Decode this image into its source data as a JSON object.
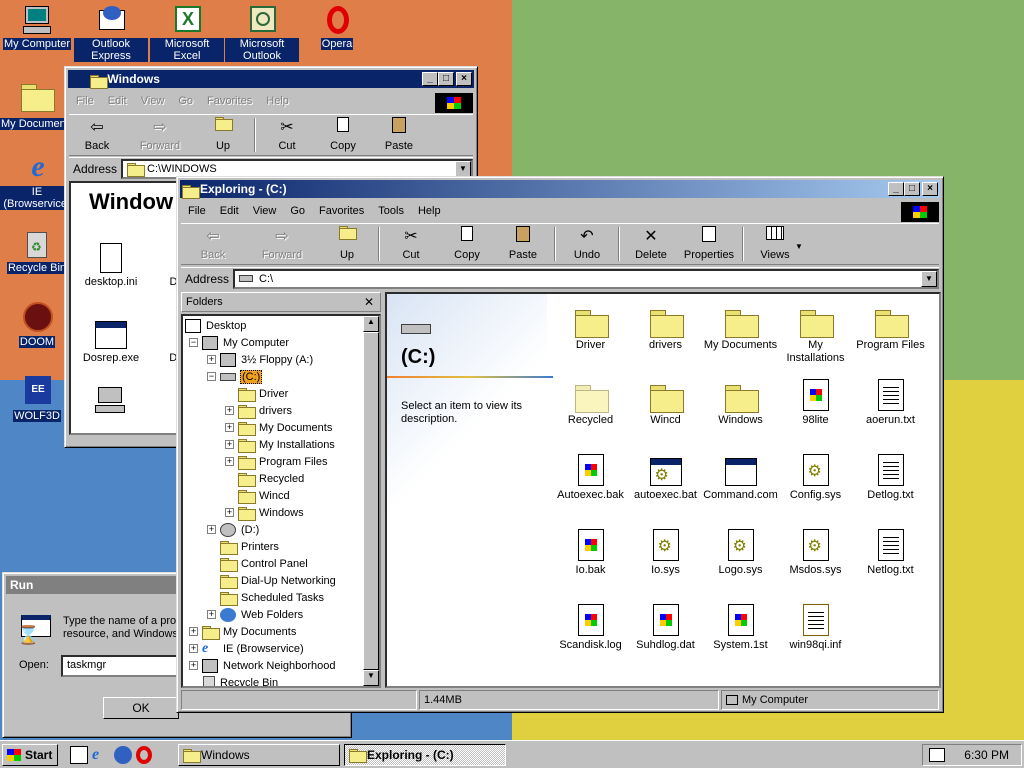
{
  "desktop": {
    "icons": [
      {
        "label": "My Computer",
        "icon": "computer-icon"
      },
      {
        "label": "Outlook Express",
        "icon": "outlook-express-icon"
      },
      {
        "label": "Microsoft Excel",
        "icon": "excel-icon"
      },
      {
        "label": "Microsoft Outlook",
        "icon": "outlook-icon"
      },
      {
        "label": "Opera",
        "icon": "opera-icon"
      },
      {
        "label": "My Documents",
        "icon": "documents-folder-icon"
      },
      {
        "label": "IE (Browservice)",
        "icon": "internet-explorer-icon"
      },
      {
        "label": "Recycle Bin",
        "icon": "recycle-bin-icon"
      },
      {
        "label": "DOOM",
        "icon": "doom-icon"
      },
      {
        "label": "WOLF3D",
        "icon": "wolf3d-icon"
      }
    ]
  },
  "windows_window": {
    "title": "Windows",
    "menu": [
      "File",
      "Edit",
      "View",
      "Go",
      "Favorites",
      "Help"
    ],
    "toolbar": [
      "Back",
      "Forward",
      "Up",
      "Cut",
      "Copy",
      "Paste"
    ],
    "address_label": "Address",
    "address_value": "C:\\WINDOWS",
    "heading": "Window",
    "items": [
      "desktop.ini",
      "Dial",
      "Dosrep.exe",
      "Dos"
    ]
  },
  "explorer": {
    "title": "Exploring - (C:)",
    "menu": [
      "File",
      "Edit",
      "View",
      "Go",
      "Favorites",
      "Tools",
      "Help"
    ],
    "toolbar": [
      "Back",
      "Forward",
      "Up",
      "Cut",
      "Copy",
      "Paste",
      "Undo",
      "Delete",
      "Properties",
      "Views"
    ],
    "address_label": "Address",
    "address_value": "C:\\",
    "folders_header": "Folders",
    "tree": [
      {
        "label": "Desktop"
      },
      {
        "label": "My Computer"
      },
      {
        "label": "3½ Floppy (A:)"
      },
      {
        "label": "(C:)"
      },
      {
        "label": "Driver"
      },
      {
        "label": "drivers"
      },
      {
        "label": "My Documents"
      },
      {
        "label": "My Installations"
      },
      {
        "label": "Program Files"
      },
      {
        "label": "Recycled"
      },
      {
        "label": "Wincd"
      },
      {
        "label": "Windows"
      },
      {
        "label": "(D:)"
      },
      {
        "label": "Printers"
      },
      {
        "label": "Control Panel"
      },
      {
        "label": "Dial-Up Networking"
      },
      {
        "label": "Scheduled Tasks"
      },
      {
        "label": "Web Folders"
      },
      {
        "label": "My Documents"
      },
      {
        "label": "IE (Browservice)"
      },
      {
        "label": "Network Neighborhood"
      },
      {
        "label": "Recycle Bin"
      }
    ],
    "drive_title": "(C:)",
    "drive_desc": "Select an item to view its description.",
    "files": [
      {
        "name": "Driver",
        "kind": "folder"
      },
      {
        "name": "drivers",
        "kind": "folder"
      },
      {
        "name": "My Documents",
        "kind": "folder"
      },
      {
        "name": "My Installations",
        "kind": "folder"
      },
      {
        "name": "Program Files",
        "kind": "folder"
      },
      {
        "name": "Recycled",
        "kind": "folder-pale"
      },
      {
        "name": "Wincd",
        "kind": "folder"
      },
      {
        "name": "Windows",
        "kind": "folder"
      },
      {
        "name": "98lite",
        "kind": "app"
      },
      {
        "name": "aoerun.txt",
        "kind": "text"
      },
      {
        "name": "Autoexec.bak",
        "kind": "winfile"
      },
      {
        "name": "autoexec.bat",
        "kind": "batch"
      },
      {
        "name": "Command.com",
        "kind": "winapp"
      },
      {
        "name": "Config.sys",
        "kind": "sys"
      },
      {
        "name": "Detlog.txt",
        "kind": "text"
      },
      {
        "name": "Io.bak",
        "kind": "winfile"
      },
      {
        "name": "Io.sys",
        "kind": "sys"
      },
      {
        "name": "Logo.sys",
        "kind": "sys"
      },
      {
        "name": "Msdos.sys",
        "kind": "sys"
      },
      {
        "name": "Netlog.txt",
        "kind": "text"
      },
      {
        "name": "Scandisk.log",
        "kind": "winfile"
      },
      {
        "name": "Suhdlog.dat",
        "kind": "winfile"
      },
      {
        "name": "System.1st",
        "kind": "winfile"
      },
      {
        "name": "win98qi.inf",
        "kind": "inf"
      }
    ],
    "status_size": "1.44MB",
    "status_location": "My Computer"
  },
  "run_dialog": {
    "title": "Run",
    "text": "Type the name of a prog resource, and Windows",
    "open_label": "Open:",
    "open_value": "taskmgr",
    "ok": "OK"
  },
  "taskbar": {
    "start": "Start",
    "tasks": [
      "Windows",
      "Exploring - (C:)"
    ],
    "time": "6:30 PM"
  },
  "colors": {
    "titlebar_active": "#0a246a",
    "desktop": "#3a6ea5",
    "highlight": "#f0a020"
  }
}
